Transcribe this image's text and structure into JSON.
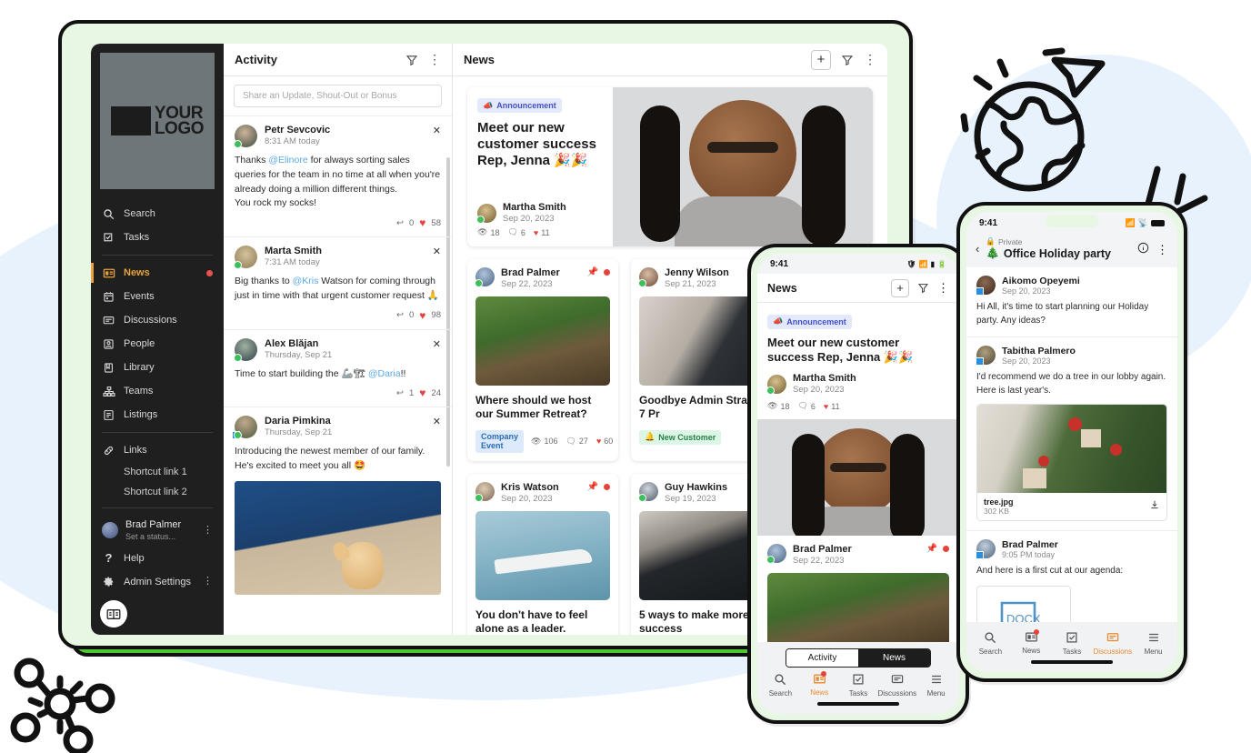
{
  "theme": {
    "accent_orange": "#e8a33d",
    "brand_green": "#4fd234",
    "frame_mint": "#e7f7e3",
    "bg_blue": "#e8f2fc",
    "sidebar_bg": "#1f1f1f",
    "heart_red": "#e8423c"
  },
  "sidebar": {
    "logo_text_line1": "YOUR",
    "logo_text_line2": "LOGO",
    "items": [
      {
        "label": "Search",
        "icon": "search-icon",
        "active": false,
        "badge": false
      },
      {
        "label": "Tasks",
        "icon": "tasks-icon",
        "active": false,
        "badge": false
      },
      {
        "label": "News",
        "icon": "news-icon",
        "active": true,
        "badge": true
      },
      {
        "label": "Events",
        "icon": "calendar-icon",
        "active": false,
        "badge": false
      },
      {
        "label": "Discussions",
        "icon": "discussions-icon",
        "active": false,
        "badge": false
      },
      {
        "label": "People",
        "icon": "people-icon",
        "active": false,
        "badge": false
      },
      {
        "label": "Library",
        "icon": "library-icon",
        "active": false,
        "badge": false
      },
      {
        "label": "Teams",
        "icon": "teams-icon",
        "active": false,
        "badge": false
      },
      {
        "label": "Listings",
        "icon": "listings-icon",
        "active": false,
        "badge": false
      }
    ],
    "links_label": "Links",
    "shortcuts": [
      "Shortcut link 1",
      "Shortcut link 2"
    ],
    "user": {
      "name": "Brad Palmer",
      "status": "Set a status..."
    },
    "help_label": "Help",
    "admin_label": "Admin Settings"
  },
  "activity": {
    "title": "Activity",
    "composer_placeholder": "Share an Update, Shout-Out or Bonus",
    "posts": [
      {
        "author": "Petr Sevcovic",
        "time": "8:31 AM today",
        "body_pre": "Thanks ",
        "mention": "@Elinore",
        "body_post": " for always sorting sales queries for the team in no time at all when you're already doing a million different things.",
        "body_line2": "You rock my socks!",
        "replies": "0",
        "likes": "58"
      },
      {
        "author": "Marta Smith",
        "time": "7:31 AM today",
        "body_pre": "Big thanks to ",
        "mention": "@Kris",
        "body_post": " Watson for coming through just in time with that urgent customer request 🙏",
        "body_line2": "",
        "replies": "0",
        "likes": "98"
      },
      {
        "author": "Alex Blăjan",
        "time": "Thursday, Sep 21",
        "body_pre": "Time to start building the 🦾🏗 ",
        "mention": "@Daria",
        "body_post": "!!",
        "body_line2": "",
        "replies": "1",
        "likes": "24"
      },
      {
        "author": "Daria Pimkina",
        "time": "Thursday, Sep 21",
        "body_pre": "Introducing the newest member of our family. He's excited to meet you all 🤩",
        "mention": "",
        "body_post": "",
        "body_line2": "",
        "replies": "",
        "likes": ""
      }
    ]
  },
  "news": {
    "title": "News",
    "hero": {
      "chip": "Announcement",
      "chip_icon": "megaphone-icon",
      "title": "Meet our new customer success Rep, Jenna 🎉🎉",
      "author": "Martha Smith",
      "date": "Sep 20, 2023",
      "views": "18",
      "comments": "6",
      "likes": "11"
    },
    "cards": [
      {
        "author": "Brad Palmer",
        "date": "Sep 22, 2023",
        "title": "Where should we host our Summer Retreat?",
        "chip": "Company Event",
        "chip_style": "event",
        "views": "106",
        "comments": "27",
        "likes": "60",
        "pinned": true
      },
      {
        "author": "Jenny Wilson",
        "date": "Sep 21, 2023",
        "title": "Goodbye Admin Strategy: 7 Pr",
        "chip": "New Customer",
        "chip_style": "customer",
        "views": "",
        "comments": "",
        "likes": "",
        "pinned": false
      },
      {
        "author": "Kris Watson",
        "date": "Sep 20, 2023",
        "title": "You don't have to feel alone as a leader.",
        "chip": "",
        "chip_style": "",
        "views": "",
        "comments": "",
        "likes": "",
        "pinned": true
      },
      {
        "author": "Guy Hawkins",
        "date": "Sep 19, 2023",
        "title": "5 ways to make more success",
        "chip": "",
        "chip_style": "",
        "views": "",
        "comments": "",
        "likes": "",
        "pinned": false
      }
    ]
  },
  "phone_center": {
    "status_time": "9:41",
    "header_title": "News",
    "hero": {
      "chip": "Announcement",
      "title": "Meet our new customer success Rep, Jenna 🎉🎉",
      "author": "Martha Smith",
      "date": "Sep 20, 2023",
      "views": "18",
      "comments": "6",
      "likes": "11"
    },
    "card": {
      "author": "Brad Palmer",
      "date": "Sep 22, 2023"
    },
    "tabs": [
      {
        "label": "Activity",
        "selected": false
      },
      {
        "label": "News",
        "selected": true
      }
    ],
    "nav": [
      {
        "label": "Search",
        "icon": "search-icon",
        "active": false,
        "badge": false
      },
      {
        "label": "News",
        "icon": "news-icon",
        "active": true,
        "badge": true
      },
      {
        "label": "Tasks",
        "icon": "tasks-icon",
        "active": false,
        "badge": false
      },
      {
        "label": "Discussions",
        "icon": "discussions-icon",
        "active": false,
        "badge": false
      },
      {
        "label": "Menu",
        "icon": "menu-icon",
        "active": false,
        "badge": false
      }
    ]
  },
  "phone_right": {
    "status_time": "9:41",
    "privacy_label": "Private",
    "header_title": "Office Holiday party",
    "header_emoji": "🎄",
    "messages": [
      {
        "author": "Aikomo Opeyemi",
        "date": "Sep 20, 2023",
        "text": "Hi All, it's time to start planning our Holiday party. Any ideas?"
      },
      {
        "author": "Tabitha Palmero",
        "date": "Sep 20, 2023",
        "text": "I'd recommend we do a tree in our lobby again. Here is last year's.",
        "attachment": {
          "name": "tree.jpg",
          "size": "302 KB"
        }
      },
      {
        "author": "Brad Palmer",
        "date": "9:05 PM today",
        "text": "And here is a first cut at our agenda:",
        "doc": "DOCX"
      }
    ],
    "nav": [
      {
        "label": "Search",
        "icon": "search-icon",
        "active": false,
        "badge": false
      },
      {
        "label": "News",
        "icon": "news-icon",
        "active": false,
        "badge": true
      },
      {
        "label": "Tasks",
        "icon": "tasks-icon",
        "active": false,
        "badge": false
      },
      {
        "label": "Discussions",
        "icon": "discussions-icon",
        "active": true,
        "badge": false
      },
      {
        "label": "Menu",
        "icon": "menu-icon",
        "active": false,
        "badge": false
      }
    ]
  }
}
